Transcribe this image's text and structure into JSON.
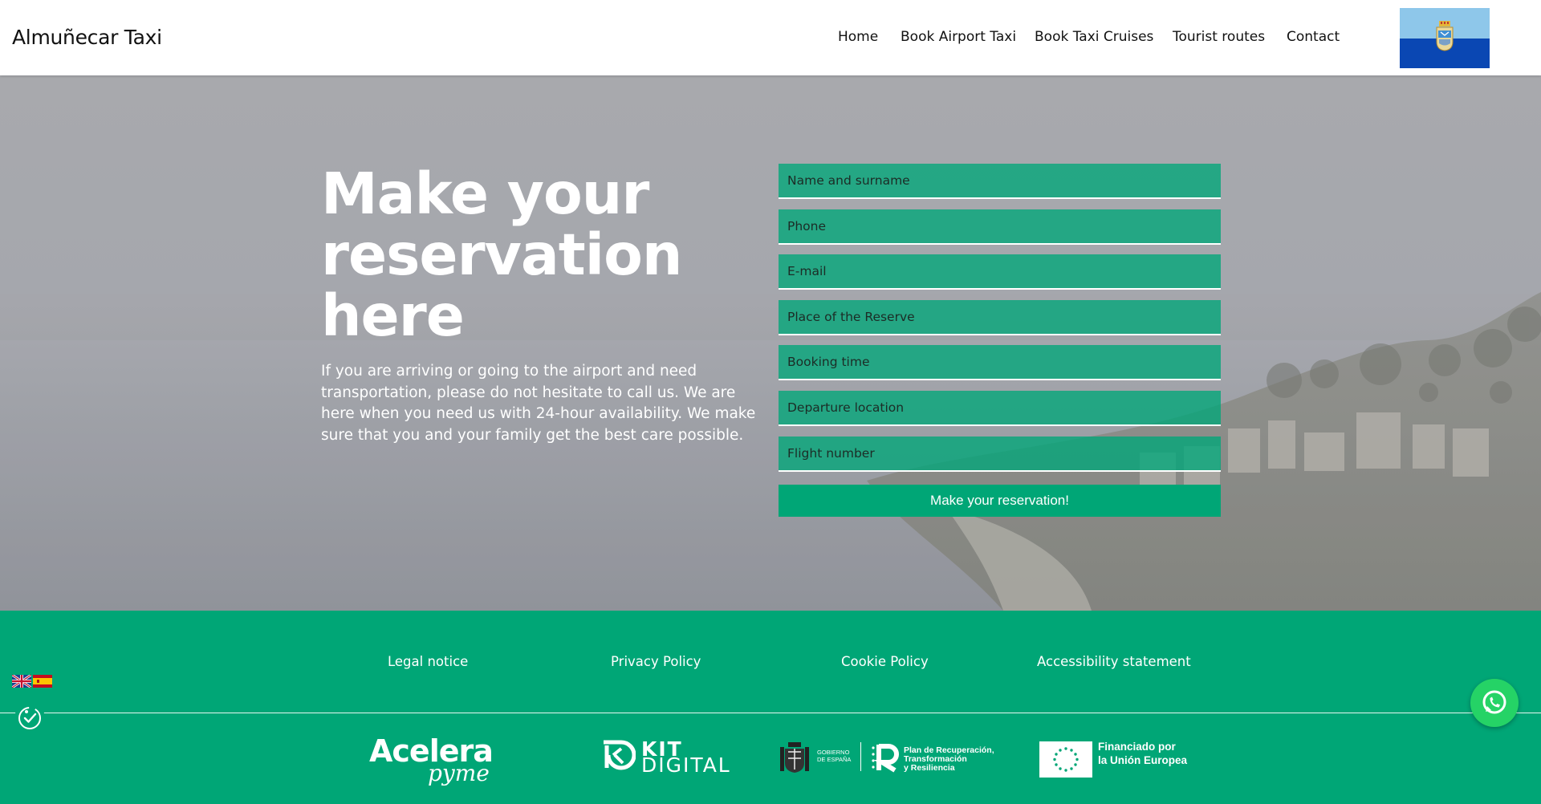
{
  "header": {
    "brand": "Almuñecar Taxi",
    "nav": [
      "Home",
      "Book Airport Taxi",
      "Book Taxi Cruises",
      "Tourist routes",
      "Contact"
    ]
  },
  "hero": {
    "title": "Make your reservation here",
    "description": "If you are arriving or going to the airport and need transportation, please do not hesitate to call us. We are here when you need us with 24-hour availability. We make sure that you and your family get the best care possible."
  },
  "form": {
    "fields": [
      {
        "placeholder": "Name and surname",
        "value": ""
      },
      {
        "placeholder": "Phone",
        "value": ""
      },
      {
        "placeholder": "E-mail",
        "value": ""
      },
      {
        "placeholder": "Place of the Reserve",
        "value": ""
      },
      {
        "placeholder": "Booking time",
        "value": ""
      },
      {
        "placeholder": "Departure location",
        "value": ""
      },
      {
        "placeholder": "Flight number",
        "value": ""
      }
    ],
    "submit_label": "Make your reservation!"
  },
  "footer": {
    "links": [
      "Legal notice",
      "Privacy Policy",
      "Cookie Policy",
      "Accessibility statement"
    ],
    "logos": {
      "acelera_line1": "Acelera",
      "acelera_line2": "pyme",
      "kit_line1": "KIT",
      "kit_line2": "DIGITAL",
      "gov_text_line1": "GOBIERNO",
      "gov_text_line2": "DE ESPAÑA",
      "plan_line1": "Plan de Recuperación,",
      "plan_line2": "Transformación",
      "plan_line3": "y Resiliencia",
      "eu_line1": "Financiado por",
      "eu_line2": "la Unión Europea"
    }
  },
  "colors": {
    "accent_green": "#00a676",
    "whatsapp_green": "#25d366",
    "flag_light_blue": "#8ec7ea",
    "flag_dark_blue": "#0a47b3"
  },
  "icons": {
    "flag": "almunecar-flag-icon",
    "lang_en": "uk-flag-icon",
    "lang_es": "spain-flag-icon",
    "accessibility": "accessibility-icon",
    "whatsapp": "whatsapp-icon"
  }
}
